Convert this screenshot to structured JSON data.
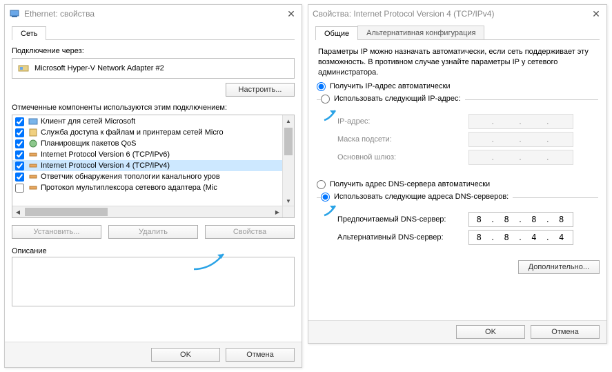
{
  "left": {
    "title": "Ethernet: свойства",
    "tab_net": "Сеть",
    "conn_via_label": "Подключение через:",
    "adapter_name": "Microsoft Hyper-V Network Adapter #2",
    "configure_btn": "Настроить...",
    "components_label": "Отмеченные компоненты используются этим подключением:",
    "items": [
      {
        "checked": true,
        "label": "Клиент для сетей Microsoft"
      },
      {
        "checked": true,
        "label": "Служба доступа к файлам и принтерам сетей Micro"
      },
      {
        "checked": true,
        "label": "Планировщик пакетов QoS"
      },
      {
        "checked": true,
        "label": "Internet Protocol Version 6 (TCP/IPv6)"
      },
      {
        "checked": true,
        "label": "Internet Protocol Version 4 (TCP/IPv4)"
      },
      {
        "checked": true,
        "label": "Ответчик обнаружения топологии канального уров"
      },
      {
        "checked": false,
        "label": "Протокол мультиплексора сетевого адаптера (Mic"
      }
    ],
    "install_btn": "Установить...",
    "remove_btn": "Удалить",
    "props_btn": "Свойства",
    "desc_label": "Описание",
    "ok_btn": "OK",
    "cancel_btn": "Отмена"
  },
  "right": {
    "title": "Свойства: Internet Protocol Version 4 (TCP/IPv4)",
    "tab_general": "Общие",
    "tab_alt": "Альтернативная конфигурация",
    "help": "Параметры IP можно назначать автоматически, если сеть поддерживает эту возможность. В противном случае узнайте параметры IP у сетевого администратора.",
    "ip_auto": "Получить IP-адрес автоматически",
    "ip_manual": "Использовать следующий IP-адрес:",
    "ip_addr_lbl": "IP-адрес:",
    "mask_lbl": "Маска подсети:",
    "gw_lbl": "Основной шлюз:",
    "dns_auto": "Получить адрес DNS-сервера автоматически",
    "dns_manual": "Использовать следующие адреса DNS-серверов:",
    "dns1_lbl": "Предпочитаемый DNS-сервер:",
    "dns2_lbl": "Альтернативный DNS-сервер:",
    "dns1_val": [
      "8",
      "8",
      "8",
      "8"
    ],
    "dns2_val": [
      "8",
      "8",
      "4",
      "4"
    ],
    "advanced_btn": "Дополнительно...",
    "ok_btn": "OK",
    "cancel_btn": "Отмена"
  }
}
